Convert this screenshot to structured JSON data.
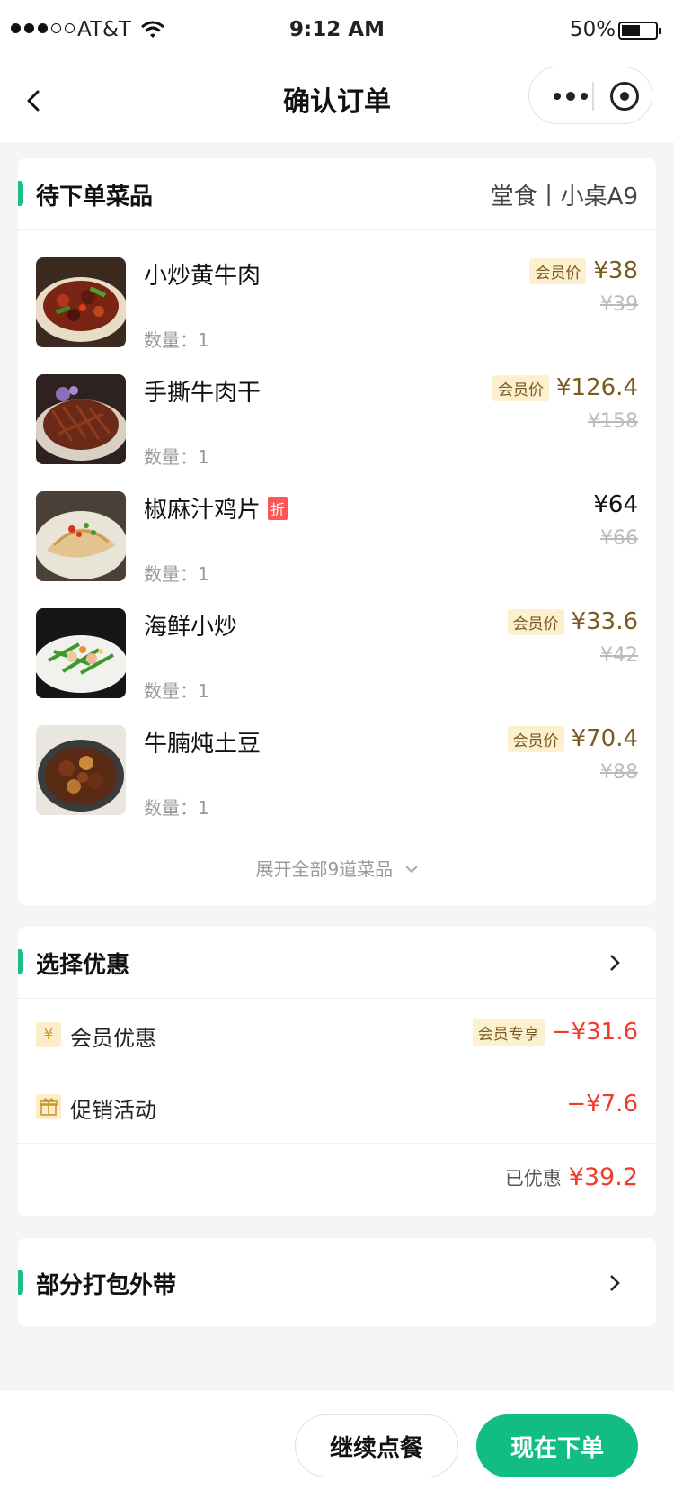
{
  "status_bar": {
    "carrier": "AT&T",
    "time": "9:12 AM",
    "battery": "50%"
  },
  "nav": {
    "title": "确认订单"
  },
  "order_card": {
    "title": "待下单菜品",
    "dine_mode": "堂食丨小桌A9",
    "dishes": [
      {
        "name": "小炒黄牛肉",
        "member_tag": "会员价",
        "price": "¥38",
        "original_price": "¥39",
        "qty": "数量：1"
      },
      {
        "name": "手撕牛肉干",
        "member_tag": "会员价",
        "price": "¥126.4",
        "original_price": "¥158",
        "qty": "数量：1"
      },
      {
        "name": "椒麻汁鸡片",
        "badge": "折",
        "price": "¥64",
        "original_price": "¥66",
        "qty": "数量：1"
      },
      {
        "name": "海鲜小炒",
        "member_tag": "会员价",
        "price": "¥33.6",
        "original_price": "¥42",
        "qty": "数量：1"
      },
      {
        "name": "牛腩炖土豆",
        "member_tag": "会员价",
        "price": "¥70.4",
        "original_price": "¥88",
        "qty": "数量：1"
      }
    ],
    "expand_label": "展开全部9道菜品"
  },
  "discount_card": {
    "title": "选择优惠",
    "rows": [
      {
        "icon": "yen-icon",
        "icon_glyph": "¥",
        "label": "会员优惠",
        "tag": "会员专享",
        "amount": "−¥31.6"
      },
      {
        "icon": "gift-icon",
        "label": "促销活动",
        "amount": "−¥7.6"
      }
    ],
    "saved_label": "已优惠",
    "saved_amount": "¥39.2"
  },
  "takeaway_card": {
    "title": "部分打包外带"
  },
  "bottom": {
    "continue_label": "继续点餐",
    "order_label": "现在下单"
  },
  "colors": {
    "accent": "#12bd84",
    "member_gold": "#7a5a22",
    "red": "#f03b2b"
  }
}
